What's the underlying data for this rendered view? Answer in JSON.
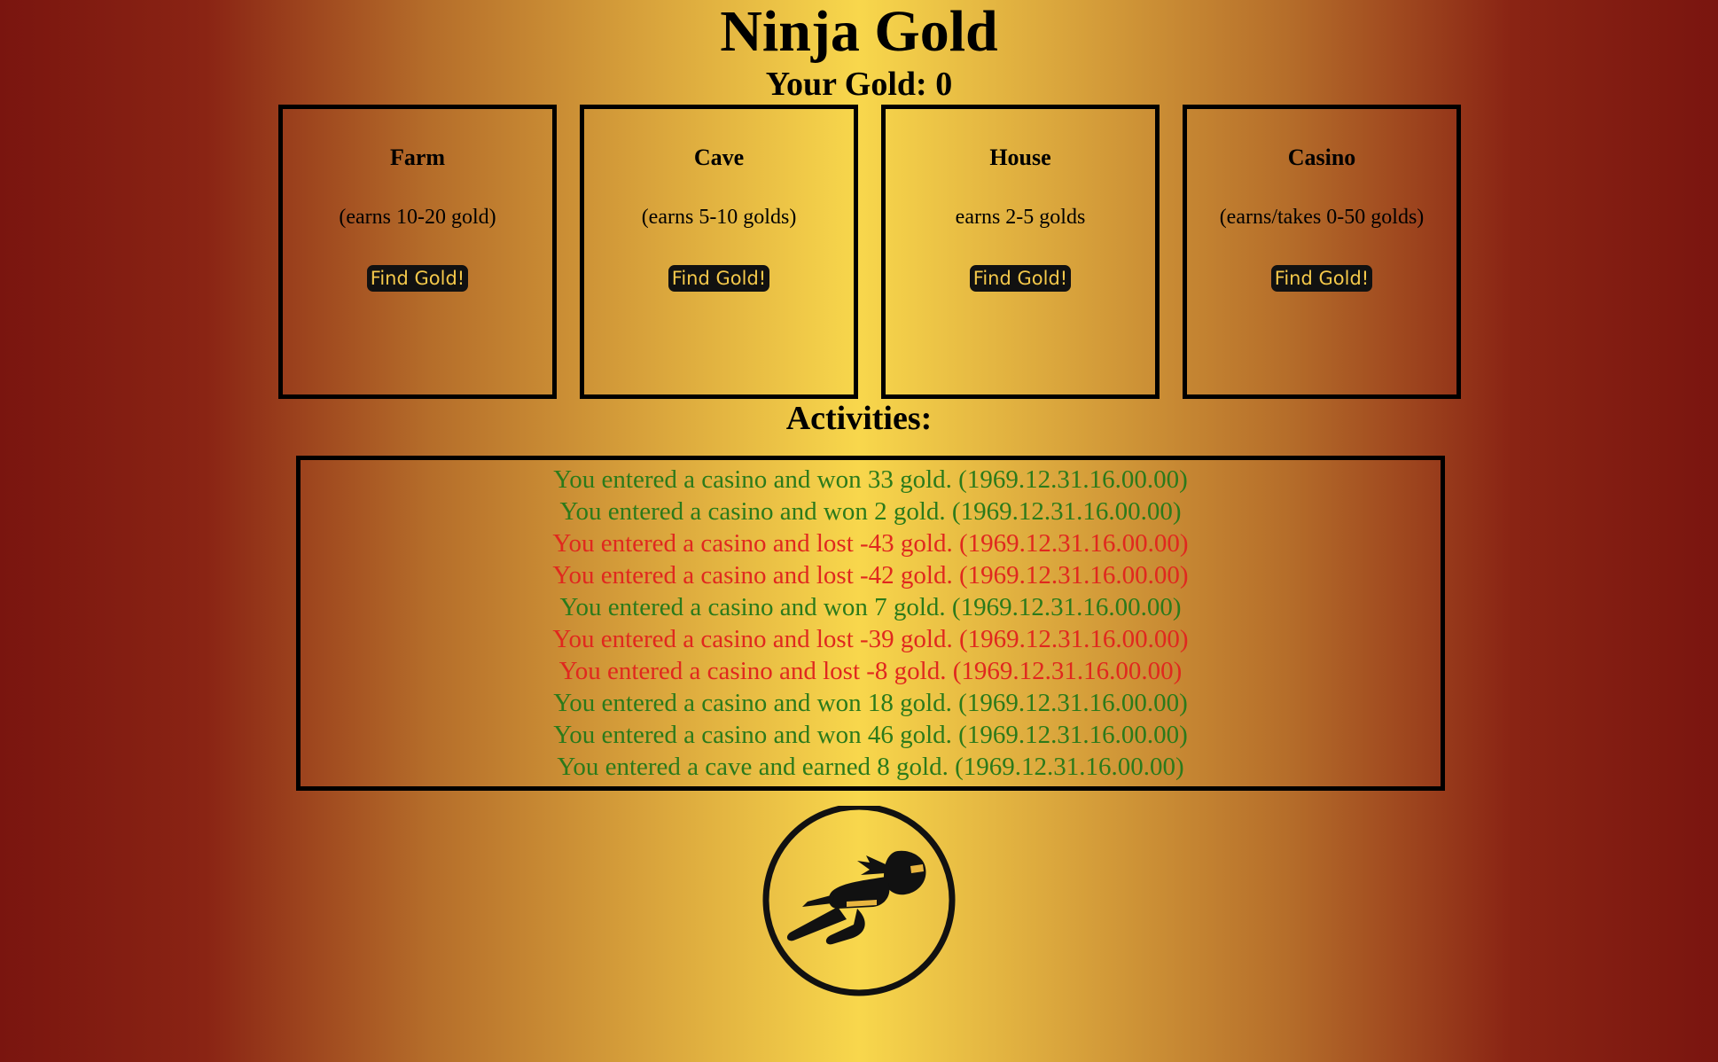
{
  "header": {
    "title": "Ninja Gold",
    "gold_label": "Your Gold:",
    "gold_value": "0"
  },
  "buildings": [
    {
      "name": "Farm",
      "description": "(earns 10-20 gold)",
      "button_label": "Find Gold!"
    },
    {
      "name": "Cave",
      "description": "(earns 5-10 golds)",
      "button_label": "Find Gold!"
    },
    {
      "name": "House",
      "description": "earns 2-5 golds",
      "button_label": "Find Gold!"
    },
    {
      "name": "Casino",
      "description": "(earns/takes 0-50 golds)",
      "button_label": "Find Gold!"
    }
  ],
  "activities": {
    "title": "Activities:",
    "entries": [
      {
        "text": "You entered a casino and won 33 gold. (1969.12.31.16.00.00)",
        "status": "won"
      },
      {
        "text": "You entered a casino and won 2 gold. (1969.12.31.16.00.00)",
        "status": "won"
      },
      {
        "text": "You entered a casino and lost -43 gold. (1969.12.31.16.00.00)",
        "status": "lost"
      },
      {
        "text": "You entered a casino and lost -42 gold. (1969.12.31.16.00.00)",
        "status": "lost"
      },
      {
        "text": "You entered a casino and won 7 gold. (1969.12.31.16.00.00)",
        "status": "won"
      },
      {
        "text": "You entered a casino and lost -39 gold. (1969.12.31.16.00.00)",
        "status": "lost"
      },
      {
        "text": "You entered a casino and lost -8 gold. (1969.12.31.16.00.00)",
        "status": "lost"
      },
      {
        "text": "You entered a casino and won 18 gold. (1969.12.31.16.00.00)",
        "status": "won"
      },
      {
        "text": "You entered a casino and won 46 gold. (1969.12.31.16.00.00)",
        "status": "won"
      },
      {
        "text": "You entered a cave and earned 8 gold. (1969.12.31.16.00.00)",
        "status": "won"
      }
    ]
  },
  "logo": {
    "icon": "ninja-logo-icon"
  },
  "colors": {
    "won": "#2b7a1a",
    "lost": "#e0281e",
    "button_bg": "#111111",
    "button_text": "#f4c84a"
  }
}
